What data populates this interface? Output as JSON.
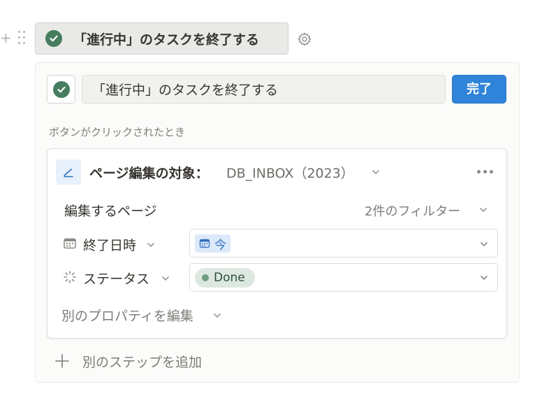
{
  "button_block": {
    "label": "「進行中」のタスクを終了する",
    "icon": "check-circle-icon",
    "icon_color": "#477d5f"
  },
  "editor": {
    "name_value": "「進行中」のタスクを終了する",
    "done_label": "完了",
    "accent_color": "#2f83d9",
    "trigger_label": "ボタンがクリックされたとき"
  },
  "action": {
    "title": "ページ編集の対象：",
    "database": "DB_INBOX（2023）",
    "pages_label": "編集するページ",
    "filter_label": "2件のフィルター",
    "properties": [
      {
        "name": "終了日時",
        "icon": "calendar-icon",
        "value": "今"
      },
      {
        "name": "ステータス",
        "icon": "status-spinner-icon",
        "value": "Done",
        "value_color": "#6f9c80"
      }
    ],
    "edit_other_label": "別のプロパティを編集"
  },
  "add_step_label": "別のステップを追加"
}
